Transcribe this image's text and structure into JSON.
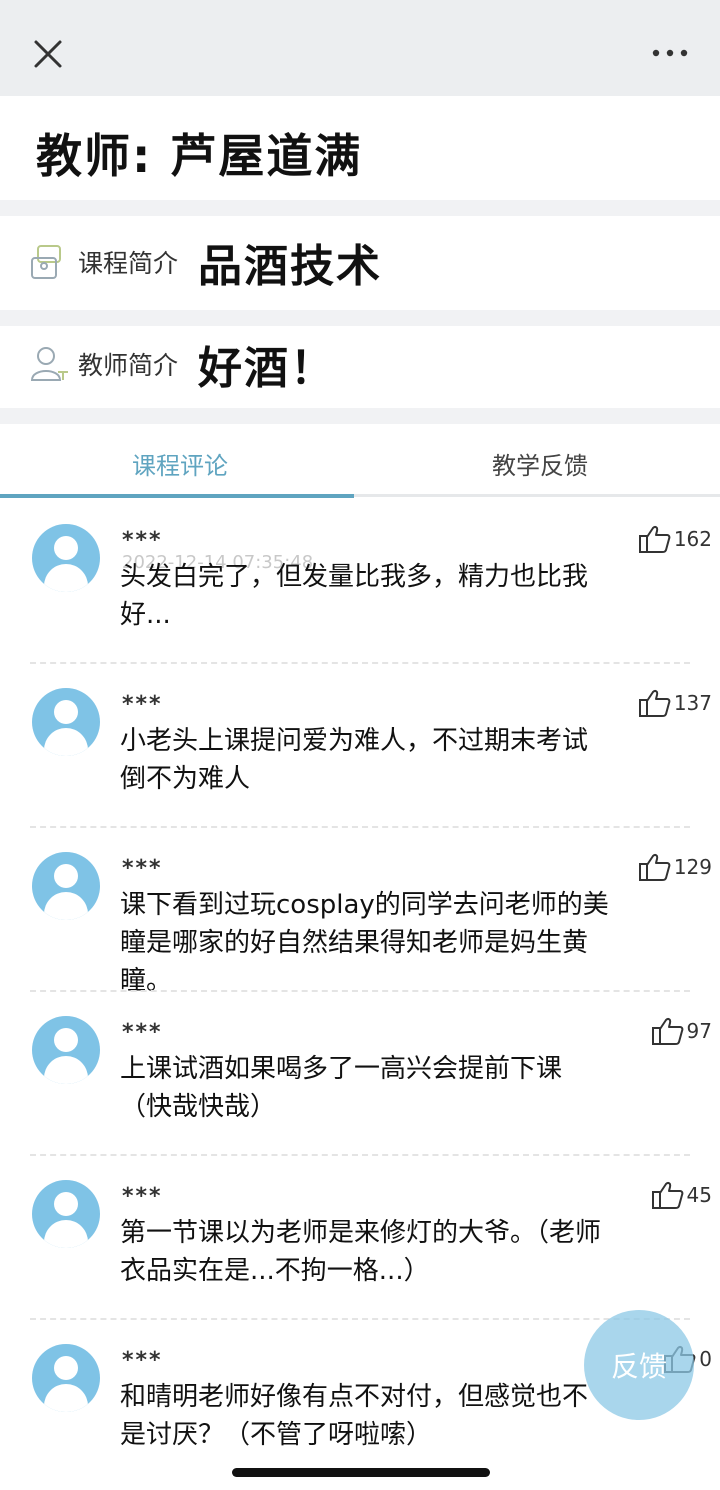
{
  "header": {
    "close_icon": "close-icon",
    "more_icon": "more-icon"
  },
  "teacher": {
    "title": "教师: 芦屋道满"
  },
  "course_intro": {
    "label": "课程简介",
    "value": "品酒技术",
    "icon": "course-icon"
  },
  "teacher_intro": {
    "label": "教师简介",
    "value": "好酒！",
    "icon": "user-icon"
  },
  "tabs": [
    {
      "label": "课程评论",
      "active": true
    },
    {
      "label": "教学反馈",
      "active": false
    }
  ],
  "colors": {
    "accent": "#5fa4c0",
    "avatar": "#7fc3e6"
  },
  "comments": [
    {
      "author": "***",
      "timestamp": "2022-12-14 07:35:48",
      "text": "头发白完了，但发量比我多，精力也比我好...",
      "likes": "162"
    },
    {
      "author": "***",
      "timestamp": "",
      "text": "小老头上课提问爱为难人，不过期末考试倒不为难人",
      "likes": "137"
    },
    {
      "author": "***",
      "timestamp": "",
      "text": "课下看到过玩cosplay的同学去问老师的美瞳是哪家的好自然结果得知老师是妈生黄瞳。",
      "likes": "129"
    },
    {
      "author": "***",
      "timestamp": "",
      "text": "上课试酒如果喝多了一高兴会提前下课（快哉快哉）",
      "likes": "97"
    },
    {
      "author": "***",
      "timestamp": "",
      "text": "第一节课以为老师是来修灯的大爷。（老师衣品实在是...不拘一格...）",
      "likes": "45"
    },
    {
      "author": "***",
      "timestamp": "",
      "text": "和晴明老师好像有点不对付，但感觉也不是讨厌？（不管了呀啦嗦）",
      "likes": "0"
    }
  ],
  "feedback_button": {
    "label": "反馈"
  }
}
